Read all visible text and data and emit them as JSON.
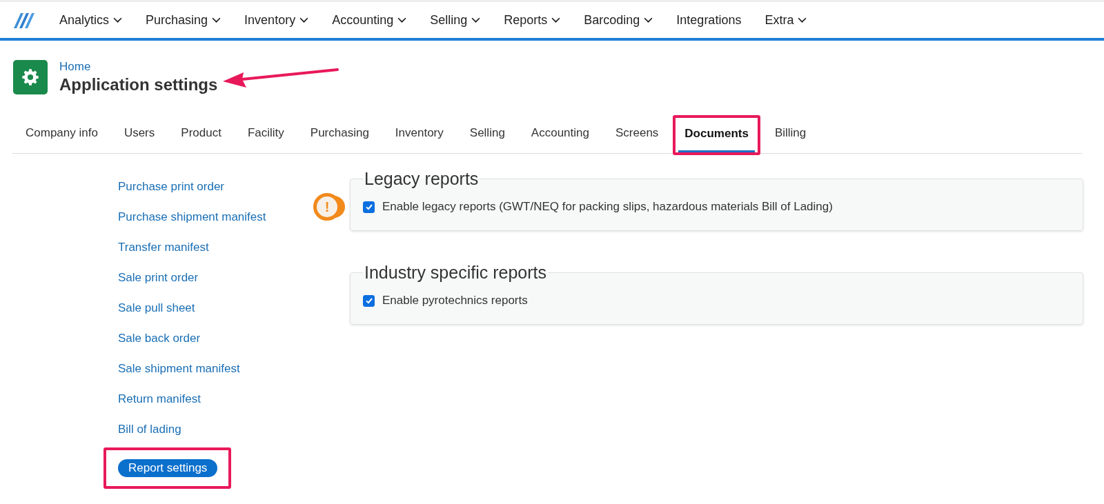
{
  "nav": {
    "items": [
      {
        "label": "Analytics",
        "has_menu": true
      },
      {
        "label": "Purchasing",
        "has_menu": true
      },
      {
        "label": "Inventory",
        "has_menu": true
      },
      {
        "label": "Accounting",
        "has_menu": true
      },
      {
        "label": "Selling",
        "has_menu": true
      },
      {
        "label": "Reports",
        "has_menu": true
      },
      {
        "label": "Barcoding",
        "has_menu": true
      },
      {
        "label": "Integrations",
        "has_menu": false
      },
      {
        "label": "Extra",
        "has_menu": true
      }
    ]
  },
  "header": {
    "breadcrumb": "Home",
    "title": "Application settings",
    "title_arrow": true
  },
  "tabs": [
    {
      "label": "Company info",
      "selected": false,
      "highlighted": false
    },
    {
      "label": "Users",
      "selected": false,
      "highlighted": false
    },
    {
      "label": "Product",
      "selected": false,
      "highlighted": false
    },
    {
      "label": "Facility",
      "selected": false,
      "highlighted": false
    },
    {
      "label": "Purchasing",
      "selected": false,
      "highlighted": false
    },
    {
      "label": "Inventory",
      "selected": false,
      "highlighted": false
    },
    {
      "label": "Selling",
      "selected": false,
      "highlighted": false
    },
    {
      "label": "Accounting",
      "selected": false,
      "highlighted": false
    },
    {
      "label": "Screens",
      "selected": false,
      "highlighted": false
    },
    {
      "label": "Documents",
      "selected": true,
      "highlighted": true
    },
    {
      "label": "Billing",
      "selected": false,
      "highlighted": false
    }
  ],
  "sidebar": {
    "items": [
      {
        "label": "Purchase print order",
        "selected": false,
        "highlighted": false
      },
      {
        "label": "Purchase shipment manifest",
        "selected": false,
        "highlighted": false
      },
      {
        "label": "Transfer manifest",
        "selected": false,
        "highlighted": false
      },
      {
        "label": "Sale print order",
        "selected": false,
        "highlighted": false
      },
      {
        "label": "Sale pull sheet",
        "selected": false,
        "highlighted": false
      },
      {
        "label": "Sale back order",
        "selected": false,
        "highlighted": false
      },
      {
        "label": "Sale shipment manifest",
        "selected": false,
        "highlighted": false
      },
      {
        "label": "Return manifest",
        "selected": false,
        "highlighted": false
      },
      {
        "label": "Bill of lading",
        "selected": false,
        "highlighted": false
      },
      {
        "label": "Report settings",
        "selected": true,
        "highlighted": true
      }
    ]
  },
  "sections": [
    {
      "title": "Legacy reports",
      "options": [
        {
          "label": "Enable legacy reports (GWT/NEQ for packing slips, hazardous materials Bill of Lading)",
          "checked": true,
          "callout": "!"
        }
      ]
    },
    {
      "title": "Industry specific reports",
      "options": [
        {
          "label": "Enable pyrotechnics reports",
          "checked": true
        }
      ]
    }
  ]
}
